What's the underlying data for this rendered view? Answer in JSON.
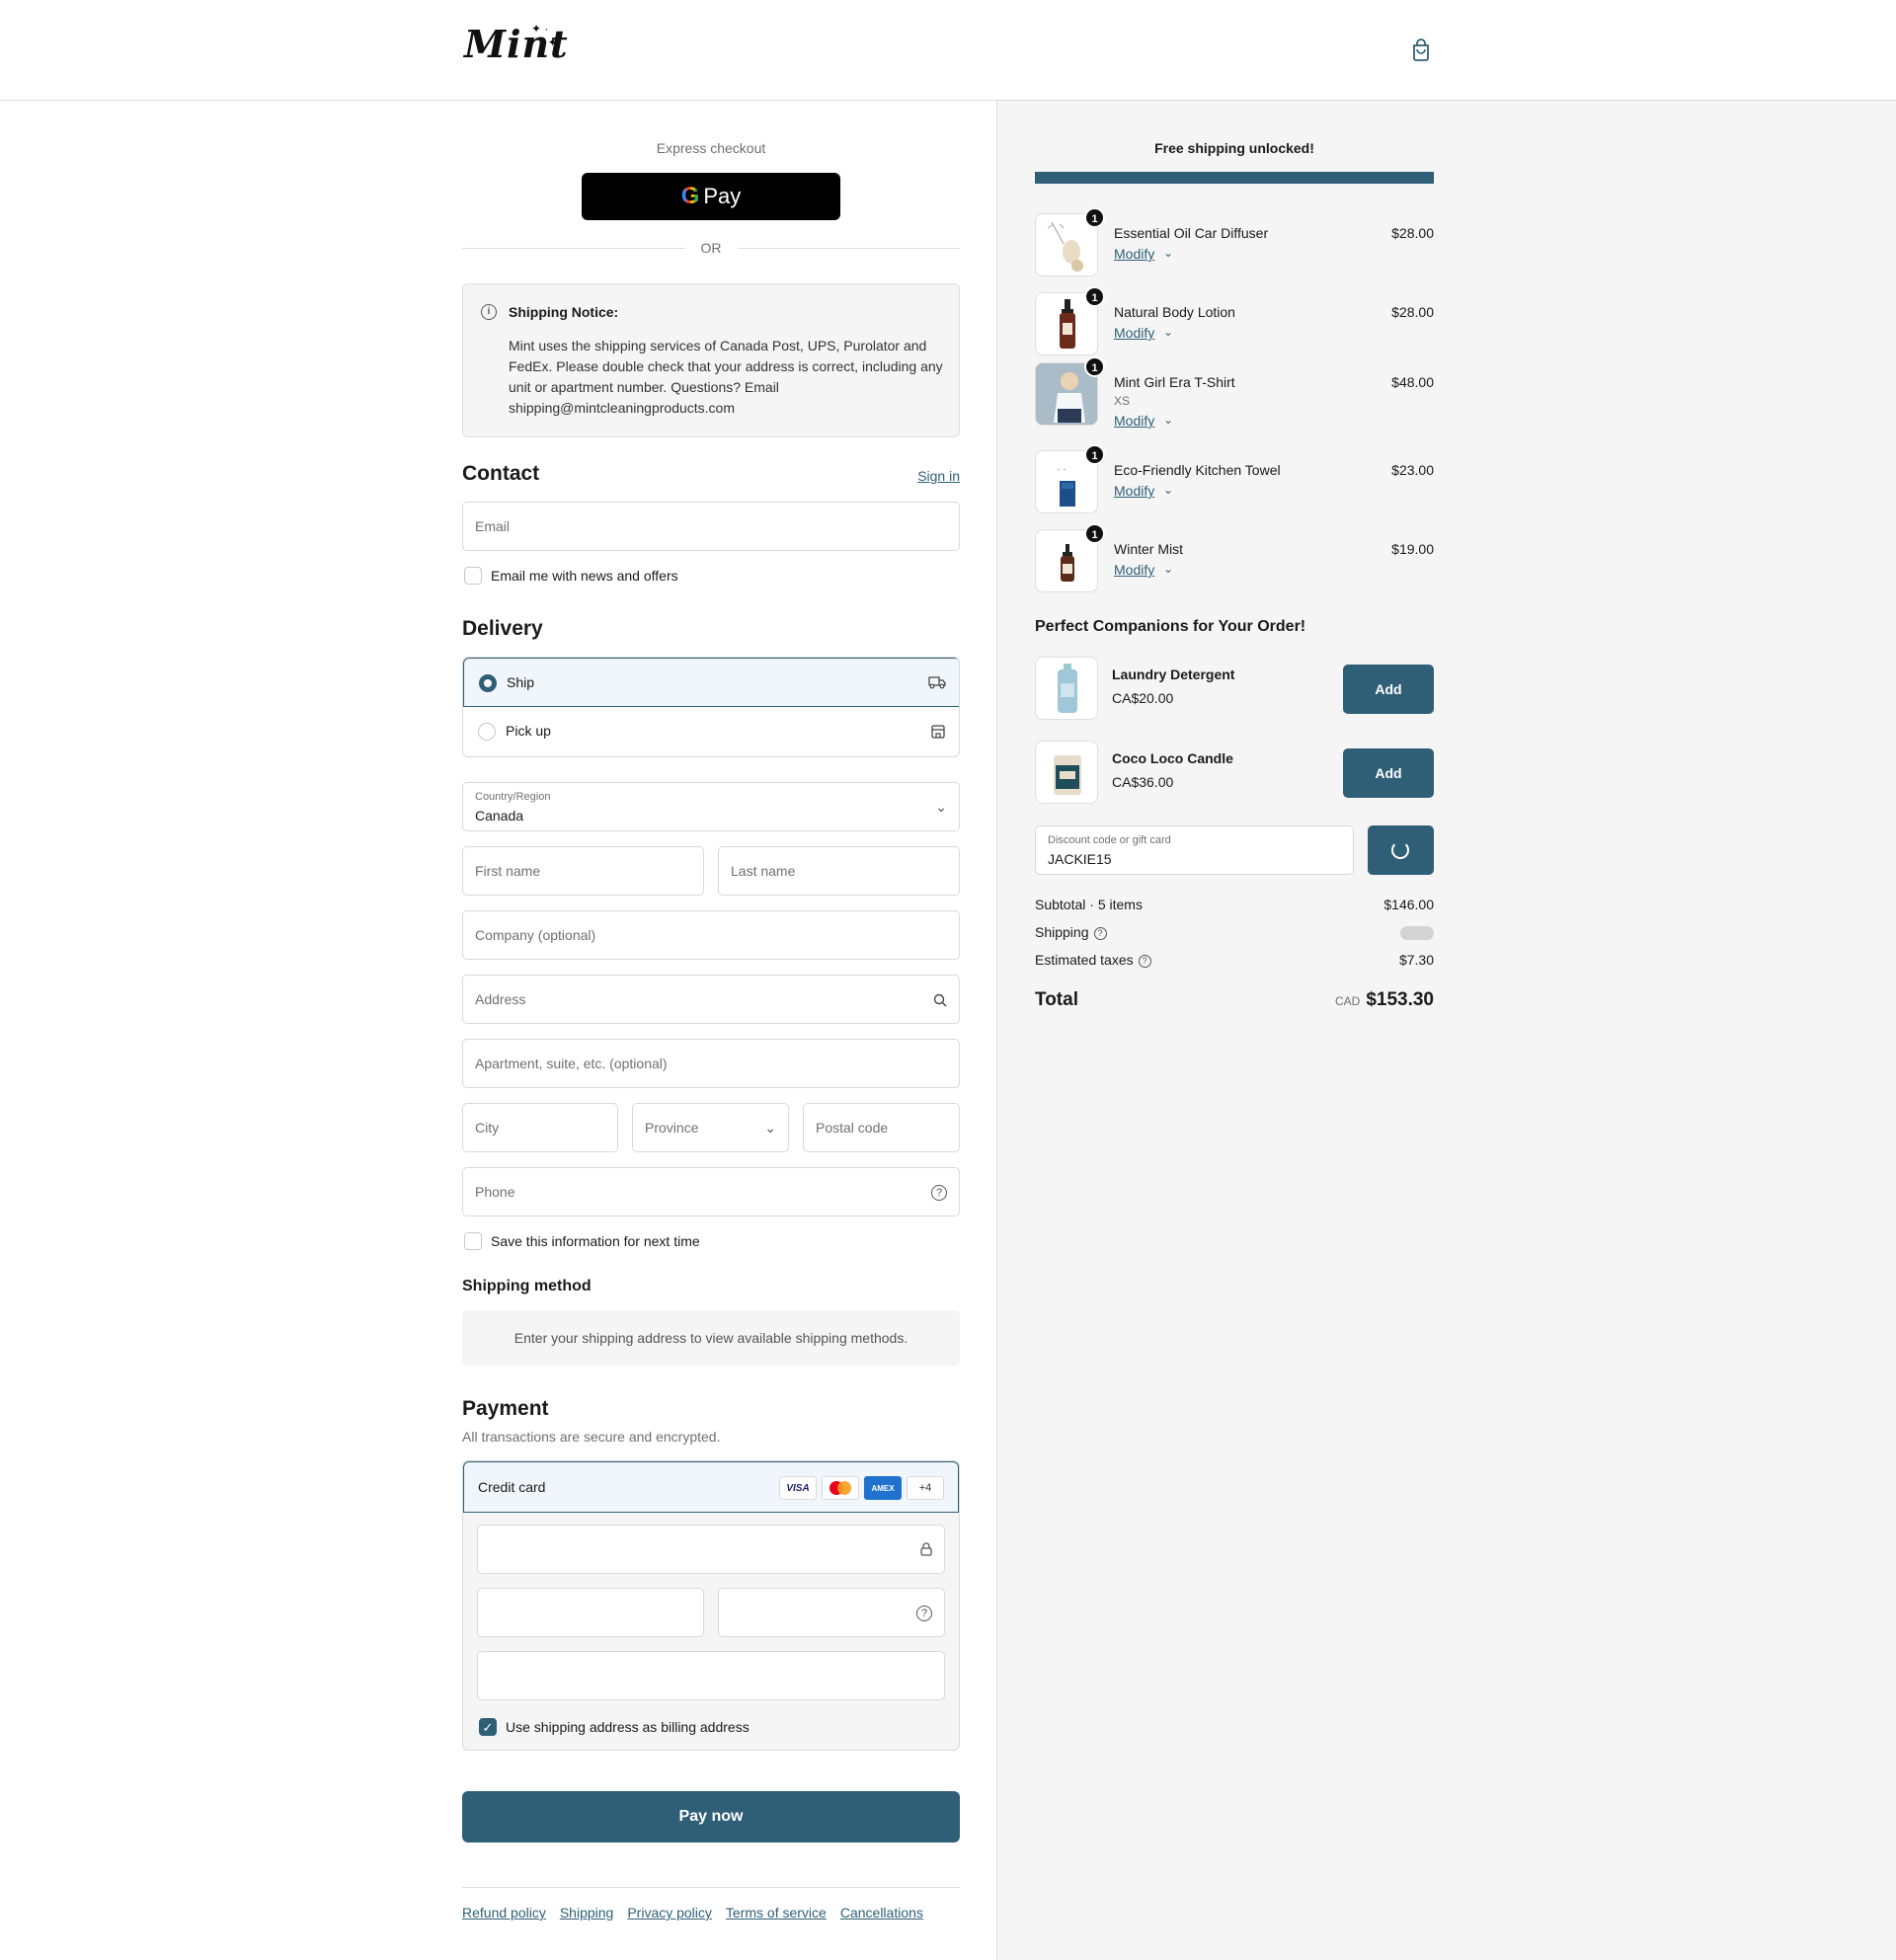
{
  "header": {
    "logo": "Mint",
    "cart_icon": "shopping-bag-icon"
  },
  "express": {
    "label": "Express checkout",
    "gpay_label": "Pay",
    "or": "OR"
  },
  "notice": {
    "title": "Shipping Notice:",
    "body": "Mint uses the shipping services of Canada Post, UPS, Purolator and FedEx. Please double check that your address is correct, including any unit or apartment number. Questions? Email shipping@mintcleaningproducts.com"
  },
  "contact": {
    "title": "Contact",
    "sign_in": "Sign in",
    "email_placeholder": "Email",
    "news_label": "Email me with news and offers"
  },
  "delivery": {
    "title": "Delivery",
    "options": [
      {
        "label": "Ship",
        "selected": true
      },
      {
        "label": "Pick up",
        "selected": false
      }
    ],
    "country_label": "Country/Region",
    "country_value": "Canada",
    "first_name": "First name",
    "last_name": "Last name",
    "company": "Company (optional)",
    "address": "Address",
    "apartment": "Apartment, suite, etc. (optional)",
    "city": "City",
    "province": "Province",
    "postal": "Postal code",
    "phone": "Phone",
    "save_info": "Save this information for next time"
  },
  "shipping_method": {
    "title": "Shipping method",
    "message": "Enter your shipping address to view available shipping methods."
  },
  "payment": {
    "title": "Payment",
    "subtitle": "All transactions are secure and encrypted.",
    "method": "Credit card",
    "cards": [
      "VISA",
      "AMEX",
      "+4"
    ],
    "billing_same": "Use shipping address as billing address",
    "pay_now": "Pay now"
  },
  "footer": {
    "links": [
      "Refund policy",
      "Shipping",
      "Privacy policy",
      "Terms of service",
      "Cancellations"
    ]
  },
  "summary": {
    "free_shipping": "Free shipping unlocked!",
    "progress": 1.0,
    "items": [
      {
        "qty": "1",
        "name": "Essential Oil Car Diffuser",
        "variant": "",
        "modify": "Modify",
        "price": "$28.00"
      },
      {
        "qty": "1",
        "name": "Natural Body Lotion",
        "variant": "",
        "modify": "Modify",
        "price": "$28.00"
      },
      {
        "qty": "1",
        "name": "Mint Girl Era T-Shirt",
        "variant": "XS",
        "modify": "Modify",
        "price": "$48.00"
      },
      {
        "qty": "1",
        "name": "Eco-Friendly Kitchen Towel",
        "variant": "",
        "modify": "Modify",
        "price": "$23.00"
      },
      {
        "qty": "1",
        "name": "Winter Mist",
        "variant": "",
        "modify": "Modify",
        "price": "$19.00"
      }
    ],
    "companions_title": "Perfect Companions for Your Order!",
    "companions": [
      {
        "name": "Laundry Detergent",
        "price": "CA$20.00",
        "add": "Add"
      },
      {
        "name": "Coco Loco Candle",
        "price": "CA$36.00",
        "add": "Add"
      }
    ],
    "discount_label": "Discount code or gift card",
    "discount_value": "JACKIE15",
    "subtotal_label": "Subtotal · 5 items",
    "subtotal": "$146.00",
    "shipping_label": "Shipping",
    "taxes_label": "Estimated taxes",
    "taxes": "$7.30",
    "total_label": "Total",
    "currency": "CAD",
    "total": "$153.30"
  },
  "colors": {
    "accent": "#2f5f77",
    "panel_bg": "#f5f5f5"
  }
}
